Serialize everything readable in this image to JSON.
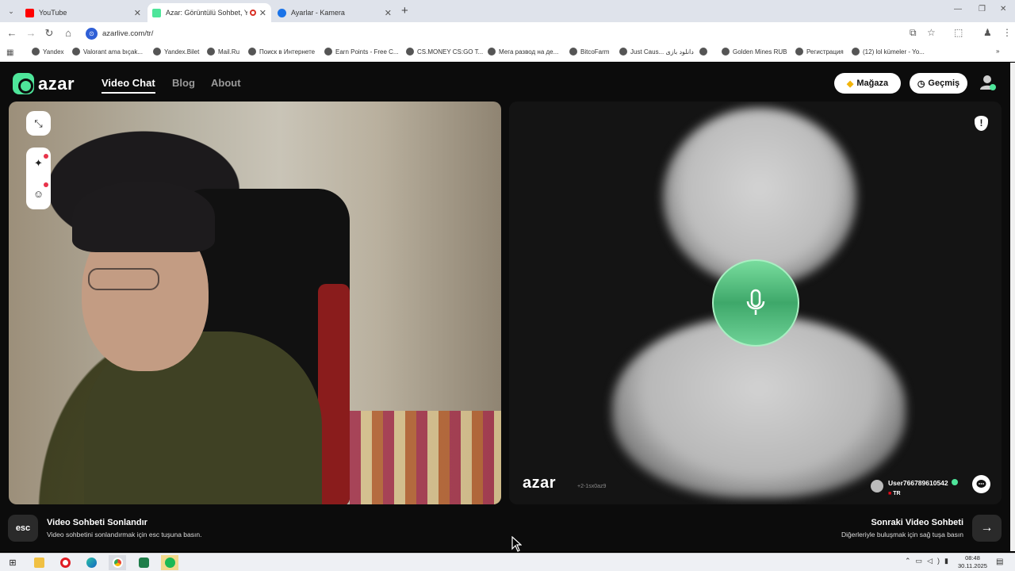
{
  "browser": {
    "tabs": [
      {
        "title": "YouTube",
        "active": false,
        "favicon_color": "#ff0000"
      },
      {
        "title": "Azar: Görüntülü Sohbet, Ye",
        "active": true,
        "favicon_color": "#4ee59a"
      },
      {
        "title": "Ayarlar - Kamera",
        "active": false,
        "favicon_color": "#1a73e8"
      }
    ],
    "url": "azarlive.com/tr/",
    "bookmarks": [
      "Yandex",
      "Valorant ama bıçak...",
      "Yandex.Bilet",
      "Mail.Ru",
      "Поиск в Интернете",
      "Earn Points - Free C...",
      "CS.MONEY CS:GO T...",
      "Мега развод на де...",
      "BitcoFarm",
      "Just Caus... دانلود بازی",
      "",
      "Golden Mines RUB",
      "Регистрация",
      "(12) lol kümeler - Yo..."
    ]
  },
  "azar": {
    "logo_text": "azar",
    "nav": {
      "video_chat": "Video Chat",
      "blog": "Blog",
      "about": "About"
    },
    "store_label": "Mağaza",
    "history_label": "Geçmiş",
    "remote": {
      "logo_text": "azar",
      "session_code": "+2-1sx0az9",
      "username": "User766789610542",
      "country": "TR"
    },
    "end_chat": {
      "key": "esc",
      "title": "Video Sohbeti Sonlandır",
      "description": "Video sohbetini sonlandırmak için esc tuşuna basın."
    },
    "next_chat": {
      "title": "Sonraki Video Sohbeti",
      "description": "Diğerleriyle buluşmak için sağ tuşa basın"
    },
    "accent_color": "#4ee59a"
  },
  "taskbar": {
    "time": "08:48",
    "date": "30.11.2025"
  }
}
